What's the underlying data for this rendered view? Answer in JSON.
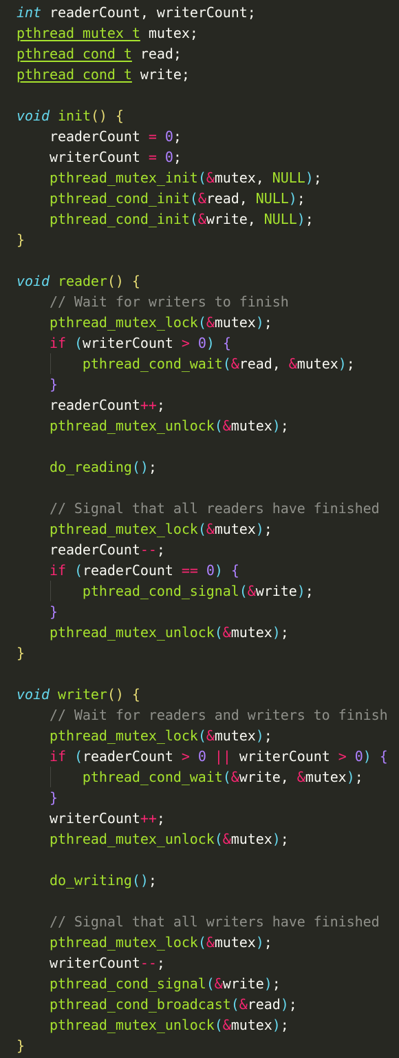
{
  "editor": {
    "theme_colors": {
      "background": "#272822",
      "default_text": "#f8f8f2",
      "keyword": "#66d9ef",
      "type": "#a6e22e",
      "function": "#a6e22e",
      "number": "#ae81ff",
      "operator": "#f92672",
      "brace": "#e6db74",
      "inner_brace": "#ae81ff",
      "comment": "#8f908a"
    },
    "lines": [
      [
        [
          "kw",
          "int"
        ],
        [
          "var",
          " readerCount, writerCount;"
        ]
      ],
      [
        [
          "type",
          "pthread_mutex_t"
        ],
        [
          "var",
          " mutex;"
        ]
      ],
      [
        [
          "type",
          "pthread_cond_t"
        ],
        [
          "var",
          " read;"
        ]
      ],
      [
        [
          "type",
          "pthread_cond_t"
        ],
        [
          "var",
          " write;"
        ]
      ],
      [],
      [
        [
          "kw",
          "void"
        ],
        [
          "var",
          " "
        ],
        [
          "fn",
          "init"
        ],
        [
          "brace",
          "()"
        ],
        [
          "var",
          " "
        ],
        [
          "brace",
          "{"
        ]
      ],
      [
        [
          "var",
          "    readerCount "
        ],
        [
          "op",
          "="
        ],
        [
          "var",
          " "
        ],
        [
          "num",
          "0"
        ],
        [
          "var",
          ";"
        ]
      ],
      [
        [
          "var",
          "    writerCount "
        ],
        [
          "op",
          "="
        ],
        [
          "var",
          " "
        ],
        [
          "num",
          "0"
        ],
        [
          "var",
          ";"
        ]
      ],
      [
        [
          "fn",
          "    pthread_mutex_init"
        ],
        [
          "paren",
          "("
        ],
        [
          "op",
          "&"
        ],
        [
          "var",
          "mutex, "
        ],
        [
          "const",
          "NULL"
        ],
        [
          "paren",
          ")"
        ],
        [
          "var",
          ";"
        ]
      ],
      [
        [
          "fn",
          "    pthread_cond_init"
        ],
        [
          "paren",
          "("
        ],
        [
          "op",
          "&"
        ],
        [
          "var",
          "read, "
        ],
        [
          "const",
          "NULL"
        ],
        [
          "paren",
          ")"
        ],
        [
          "var",
          ";"
        ]
      ],
      [
        [
          "fn",
          "    pthread_cond_init"
        ],
        [
          "paren",
          "("
        ],
        [
          "op",
          "&"
        ],
        [
          "var",
          "write, "
        ],
        [
          "const",
          "NULL"
        ],
        [
          "paren",
          ")"
        ],
        [
          "var",
          ";"
        ]
      ],
      [
        [
          "brace",
          "}"
        ]
      ],
      [],
      [
        [
          "kw",
          "void"
        ],
        [
          "var",
          " "
        ],
        [
          "fn",
          "reader"
        ],
        [
          "brace",
          "()"
        ],
        [
          "var",
          " "
        ],
        [
          "brace",
          "{"
        ]
      ],
      [
        [
          "cm",
          "    // Wait for writers to finish"
        ]
      ],
      [
        [
          "fn",
          "    pthread_mutex_lock"
        ],
        [
          "paren",
          "("
        ],
        [
          "op",
          "&"
        ],
        [
          "var",
          "mutex"
        ],
        [
          "paren",
          ")"
        ],
        [
          "var",
          ";"
        ]
      ],
      [
        [
          "var",
          "    "
        ],
        [
          "ctrl",
          "if"
        ],
        [
          "var",
          " "
        ],
        [
          "paren",
          "("
        ],
        [
          "var",
          "writerCount "
        ],
        [
          "op",
          ">"
        ],
        [
          "var",
          " "
        ],
        [
          "num",
          "0"
        ],
        [
          "paren",
          ")"
        ],
        [
          "var",
          " "
        ],
        [
          "brace2",
          "{"
        ]
      ],
      [
        [
          "fn",
          "        pthread_cond_wait"
        ],
        [
          "paren",
          "("
        ],
        [
          "op",
          "&"
        ],
        [
          "var",
          "read, "
        ],
        [
          "op",
          "&"
        ],
        [
          "var",
          "mutex"
        ],
        [
          "paren",
          ")"
        ],
        [
          "var",
          ";"
        ]
      ],
      [
        [
          "var",
          "    "
        ],
        [
          "brace2",
          "}"
        ]
      ],
      [
        [
          "var",
          "    readerCount"
        ],
        [
          "op",
          "++"
        ],
        [
          "var",
          ";"
        ]
      ],
      [
        [
          "fn",
          "    pthread_mutex_unlock"
        ],
        [
          "paren",
          "("
        ],
        [
          "op",
          "&"
        ],
        [
          "var",
          "mutex"
        ],
        [
          "paren",
          ")"
        ],
        [
          "var",
          ";"
        ]
      ],
      [],
      [
        [
          "fn",
          "    do_reading"
        ],
        [
          "paren",
          "()"
        ],
        [
          "var",
          ";"
        ]
      ],
      [],
      [
        [
          "cm",
          "    // Signal that all readers have finished"
        ]
      ],
      [
        [
          "fn",
          "    pthread_mutex_lock"
        ],
        [
          "paren",
          "("
        ],
        [
          "op",
          "&"
        ],
        [
          "var",
          "mutex"
        ],
        [
          "paren",
          ")"
        ],
        [
          "var",
          ";"
        ]
      ],
      [
        [
          "var",
          "    readerCount"
        ],
        [
          "op",
          "--"
        ],
        [
          "var",
          ";"
        ]
      ],
      [
        [
          "var",
          "    "
        ],
        [
          "ctrl",
          "if"
        ],
        [
          "var",
          " "
        ],
        [
          "paren",
          "("
        ],
        [
          "var",
          "readerCount "
        ],
        [
          "op",
          "=="
        ],
        [
          "var",
          " "
        ],
        [
          "num",
          "0"
        ],
        [
          "paren",
          ")"
        ],
        [
          "var",
          " "
        ],
        [
          "brace2",
          "{"
        ]
      ],
      [
        [
          "fn",
          "        pthread_cond_signal"
        ],
        [
          "paren",
          "("
        ],
        [
          "op",
          "&"
        ],
        [
          "var",
          "write"
        ],
        [
          "paren",
          ")"
        ],
        [
          "var",
          ";"
        ]
      ],
      [
        [
          "var",
          "    "
        ],
        [
          "brace2",
          "}"
        ]
      ],
      [
        [
          "fn",
          "    pthread_mutex_unlock"
        ],
        [
          "paren",
          "("
        ],
        [
          "op",
          "&"
        ],
        [
          "var",
          "mutex"
        ],
        [
          "paren",
          ")"
        ],
        [
          "var",
          ";"
        ]
      ],
      [
        [
          "brace",
          "}"
        ]
      ],
      [],
      [
        [
          "kw",
          "void"
        ],
        [
          "var",
          " "
        ],
        [
          "fn",
          "writer"
        ],
        [
          "brace",
          "()"
        ],
        [
          "var",
          " "
        ],
        [
          "brace",
          "{"
        ]
      ],
      [
        [
          "cm",
          "    // Wait for readers and writers to finish"
        ]
      ],
      [
        [
          "fn",
          "    pthread_mutex_lock"
        ],
        [
          "paren",
          "("
        ],
        [
          "op",
          "&"
        ],
        [
          "var",
          "mutex"
        ],
        [
          "paren",
          ")"
        ],
        [
          "var",
          ";"
        ]
      ],
      [
        [
          "var",
          "    "
        ],
        [
          "ctrl",
          "if"
        ],
        [
          "var",
          " "
        ],
        [
          "paren",
          "("
        ],
        [
          "var",
          "readerCount "
        ],
        [
          "op",
          ">"
        ],
        [
          "var",
          " "
        ],
        [
          "num",
          "0"
        ],
        [
          "var",
          " "
        ],
        [
          "op",
          "||"
        ],
        [
          "var",
          " writerCount "
        ],
        [
          "op",
          ">"
        ],
        [
          "var",
          " "
        ],
        [
          "num",
          "0"
        ],
        [
          "paren",
          ")"
        ],
        [
          "var",
          " "
        ],
        [
          "brace2",
          "{"
        ]
      ],
      [
        [
          "fn",
          "        pthread_cond_wait"
        ],
        [
          "paren",
          "("
        ],
        [
          "op",
          "&"
        ],
        [
          "var",
          "write, "
        ],
        [
          "op",
          "&"
        ],
        [
          "var",
          "mutex"
        ],
        [
          "paren",
          ")"
        ],
        [
          "var",
          ";"
        ]
      ],
      [
        [
          "var",
          "    "
        ],
        [
          "brace2",
          "}"
        ]
      ],
      [
        [
          "var",
          "    writerCount"
        ],
        [
          "op",
          "++"
        ],
        [
          "var",
          ";"
        ]
      ],
      [
        [
          "fn",
          "    pthread_mutex_unlock"
        ],
        [
          "paren",
          "("
        ],
        [
          "op",
          "&"
        ],
        [
          "var",
          "mutex"
        ],
        [
          "paren",
          ")"
        ],
        [
          "var",
          ";"
        ]
      ],
      [],
      [
        [
          "fn",
          "    do_writing"
        ],
        [
          "paren",
          "()"
        ],
        [
          "var",
          ";"
        ]
      ],
      [],
      [
        [
          "cm",
          "    // Signal that all writers have finished"
        ]
      ],
      [
        [
          "fn",
          "    pthread_mutex_lock"
        ],
        [
          "paren",
          "("
        ],
        [
          "op",
          "&"
        ],
        [
          "var",
          "mutex"
        ],
        [
          "paren",
          ")"
        ],
        [
          "var",
          ";"
        ]
      ],
      [
        [
          "var",
          "    writerCount"
        ],
        [
          "op",
          "--"
        ],
        [
          "var",
          ";"
        ]
      ],
      [
        [
          "fn",
          "    pthread_cond_signal"
        ],
        [
          "paren",
          "("
        ],
        [
          "op",
          "&"
        ],
        [
          "var",
          "write"
        ],
        [
          "paren",
          ")"
        ],
        [
          "var",
          ";"
        ]
      ],
      [
        [
          "fn",
          "    pthread_cond_broadcast"
        ],
        [
          "paren",
          "("
        ],
        [
          "op",
          "&"
        ],
        [
          "var",
          "read"
        ],
        [
          "paren",
          ")"
        ],
        [
          "var",
          ";"
        ]
      ],
      [
        [
          "fn",
          "    pthread_mutex_unlock"
        ],
        [
          "paren",
          "("
        ],
        [
          "op",
          "&"
        ],
        [
          "var",
          "mutex"
        ],
        [
          "paren",
          ")"
        ],
        [
          "var",
          ";"
        ]
      ],
      [
        [
          "brace",
          "}"
        ]
      ]
    ]
  }
}
